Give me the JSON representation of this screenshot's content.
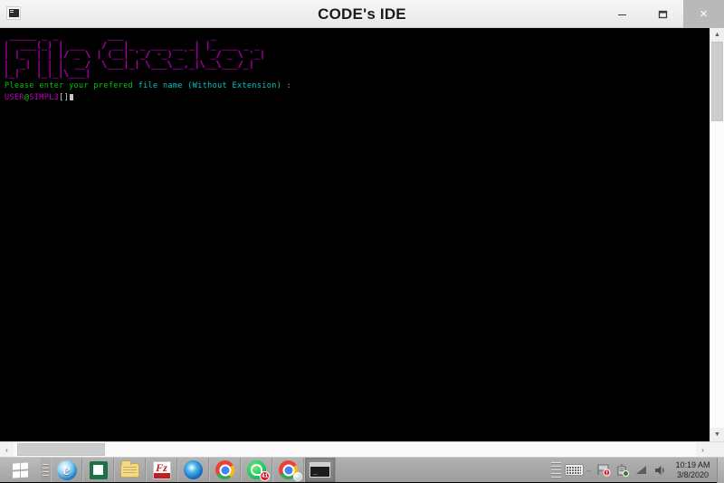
{
  "window": {
    "title": "CODE's IDE",
    "icon_name": "console-window-icon",
    "controls": {
      "minimize_label": "–",
      "maximize_label": "❐",
      "close_label": "×"
    }
  },
  "terminal": {
    "banner_alt": "File Creator",
    "banner_lines": [
      " _____ _ _         ___                _              ",
      "|  ___(_) | ___   / __|_ _ ___ __ _| |_ ___ _ _    ",
      "| |_  | | |/ _ \\ | (__| '_/ -_) _` |  _/ _ \\ '_|   ",
      "|  _| | | |  __/  \\___|_| \\___\\__,_|\\__\\___/_|     ",
      "|_|   |_|_|\\___|                                    "
    ],
    "prompt_message_green": "Please enter your prefered ",
    "prompt_message_cyan": "file name (Without Extension)",
    "prompt_message_tail": " :",
    "shell_user": "USER",
    "shell_at": "@",
    "shell_host": "SIMPL3",
    "shell_brackets": "[]",
    "shell_input_value": "",
    "colors": {
      "background": "#000000",
      "banner": "#b400b4",
      "green": "#00c400",
      "cyan": "#00c5c5",
      "magenta": "#c000c0",
      "white": "#d8d8d8"
    }
  },
  "scrollbars": {
    "vertical": {
      "up_arrow": "▲",
      "down_arrow": "▼"
    },
    "horizontal": {
      "left_arrow": "‹",
      "right_arrow": "›"
    }
  },
  "taskbar": {
    "start_label": "Start",
    "items": [
      {
        "name": "internet-explorer",
        "label": "Internet Explorer"
      },
      {
        "name": "excel",
        "label": "Microsoft Excel"
      },
      {
        "name": "file-explorer",
        "label": "File Explorer"
      },
      {
        "name": "filezilla",
        "label": "FileZilla"
      },
      {
        "name": "firefox",
        "label": "Firefox"
      },
      {
        "name": "chrome",
        "label": "Google Chrome"
      },
      {
        "name": "whatsapp",
        "label": "WhatsApp",
        "badge": "41"
      },
      {
        "name": "chrome-app",
        "label": "Chrome App"
      },
      {
        "name": "console-window",
        "label": "CODE's IDE",
        "active": true
      }
    ],
    "tray": {
      "keyboard_label": "Keyboard layout",
      "separator": "–",
      "security_label": "Security alert",
      "hardware_label": "Safely remove hardware",
      "network_label": "Network",
      "volume_label": "Volume",
      "time": "10:19 AM",
      "date": "3/8/2020"
    }
  }
}
